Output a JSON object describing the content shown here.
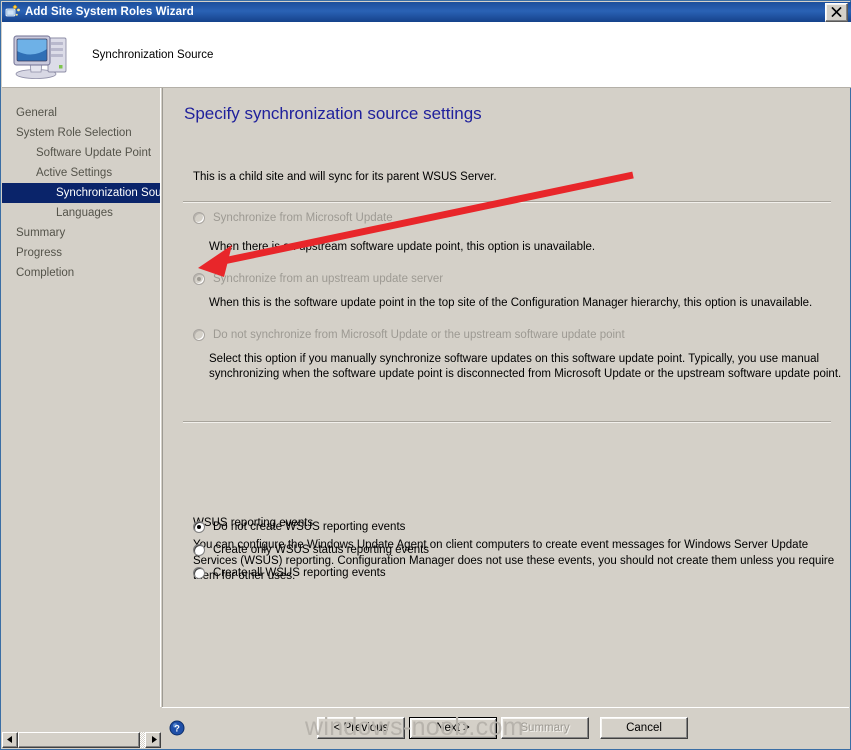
{
  "window": {
    "title": "Add Site System Roles Wizard",
    "title_icon": "wizard-icon",
    "close_label": "×"
  },
  "header": {
    "icon": "computer-icon",
    "text": "Synchronization Source"
  },
  "sidebar": {
    "items": [
      {
        "label": "General",
        "level": 1,
        "current": false
      },
      {
        "label": "System Role Selection",
        "level": 1,
        "current": false
      },
      {
        "label": "Software Update Point",
        "level": 2,
        "current": false
      },
      {
        "label": "Active Settings",
        "level": 2,
        "current": false
      },
      {
        "label": "Synchronization Source",
        "level": 3,
        "current": true
      },
      {
        "label": "Languages",
        "level": 3,
        "current": false
      },
      {
        "label": "Summary",
        "level": 1,
        "current": false
      },
      {
        "label": "Progress",
        "level": 1,
        "current": false
      },
      {
        "label": "Completion",
        "level": 1,
        "current": false
      }
    ]
  },
  "content": {
    "heading": "Specify synchronization source settings",
    "intro": "This is a child site and will sync for its parent WSUS Server.",
    "sync_options": [
      {
        "label": "Synchronize from Microsoft Update",
        "description": "When there is an upstream software update point, this option is unavailable.",
        "selected": false,
        "disabled": true
      },
      {
        "label": "Synchronize from an upstream update server",
        "description": "When this is the software update point in the top site of the Configuration Manager hierarchy, this option is unavailable.",
        "selected": true,
        "disabled": true
      },
      {
        "label": "Do not synchronize from Microsoft Update or the upstream software update point",
        "description": "Select this option if you manually synchronize software updates on this software update point. Typically, you use manual synchronizing when the software update point is disconnected from Microsoft Update or the upstream software update point.",
        "selected": false,
        "disabled": true
      }
    ],
    "reporting_group": {
      "title": "WSUS reporting events",
      "body": "You can configure the Windows Update Agent on client computers to create event messages for Windows Server Update Services (WSUS) reporting. Configuration Manager does not use these events, you should not create them unless you require them for other uses.",
      "options": [
        {
          "label": "Do not create WSUS reporting events",
          "selected": true,
          "disabled": false
        },
        {
          "label": "Create only WSUS status reporting events",
          "selected": false,
          "disabled": false
        },
        {
          "label": "Create all WSUS reporting events",
          "selected": false,
          "disabled": false
        }
      ]
    }
  },
  "footer": {
    "help_icon": "help-icon",
    "buttons": [
      {
        "label": "< Previous",
        "disabled": false,
        "default": false
      },
      {
        "label": "Next >",
        "disabled": false,
        "default": true
      },
      {
        "label": "Summary",
        "disabled": true,
        "default": false
      },
      {
        "label": "Cancel",
        "disabled": false,
        "default": false
      }
    ]
  },
  "watermark": {
    "text": "windows-noob.com"
  },
  "annotation": {
    "color": "#e8262a",
    "type": "arrow"
  },
  "scrollbar": {
    "left_arrow": "◀",
    "right_arrow": "▶"
  }
}
